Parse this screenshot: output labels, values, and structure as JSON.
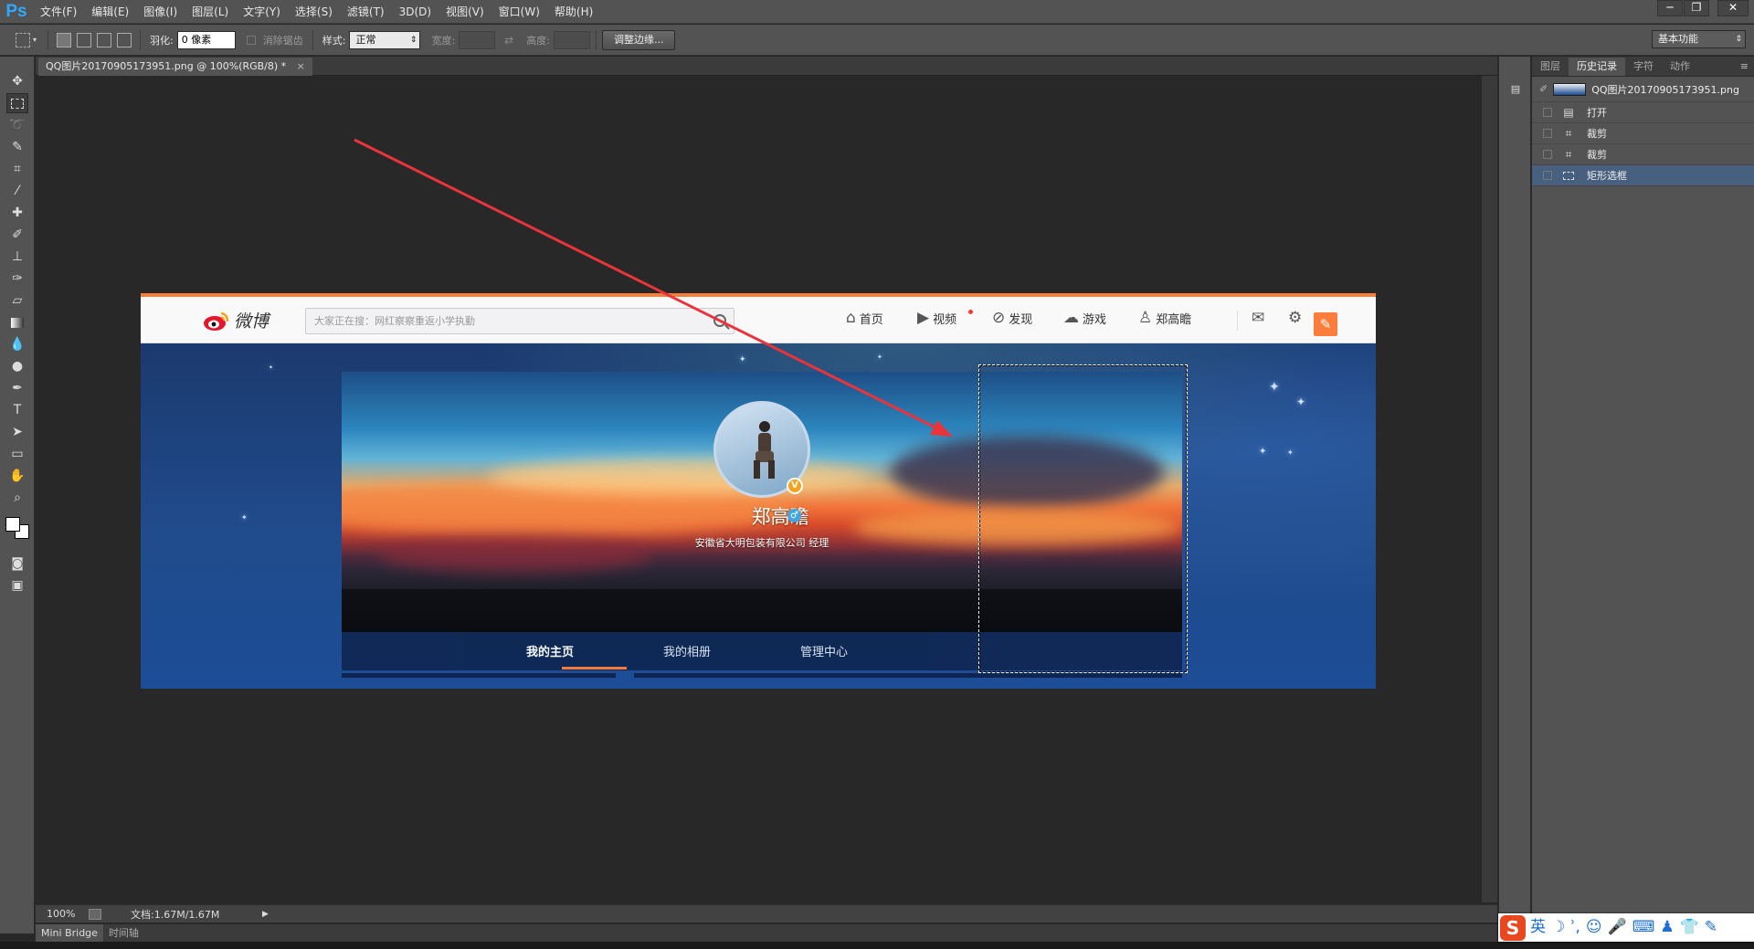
{
  "app": {
    "logo": "Ps"
  },
  "menu": [
    "文件(F)",
    "编辑(E)",
    "图像(I)",
    "图层(L)",
    "文字(Y)",
    "选择(S)",
    "滤镜(T)",
    "3D(D)",
    "视图(V)",
    "窗口(W)",
    "帮助(H)"
  ],
  "window_controls": [
    "─",
    "❐",
    "✕"
  ],
  "options": {
    "feather_label": "羽化:",
    "feather_value": "0 像素",
    "antialias_label": "消除锯齿",
    "style_label": "样式:",
    "style_value": "正常",
    "width_label": "宽度:",
    "height_label": "高度:",
    "refine_button": "调整边缘...",
    "workspace": "基本功能"
  },
  "document": {
    "tab_title": "QQ图片20170905173951.png @ 100%(RGB/8) *",
    "close": "×"
  },
  "status": {
    "zoom": "100%",
    "doc_info": "文档:1.67M/1.67M"
  },
  "bottom_tabs": [
    "Mini Bridge",
    "时间轴"
  ],
  "panel": {
    "tabs": [
      "图层",
      "历史记录",
      "字符",
      "动作"
    ],
    "active_tab": "历史记录",
    "snapshot": "QQ图片20170905173951.png",
    "history": [
      {
        "label": "打开",
        "icon": "document-icon"
      },
      {
        "label": "裁剪",
        "icon": "crop-icon"
      },
      {
        "label": "裁剪",
        "icon": "crop-icon"
      },
      {
        "label": "矩形选框",
        "icon": "marquee-icon"
      }
    ],
    "selected_history": 3
  },
  "ime": {
    "lang": "英",
    "icons": [
      "☽",
      "ʾ,",
      "☺",
      "🎤",
      "⌨",
      "♟",
      "👕",
      "✎"
    ]
  },
  "weibo": {
    "logo_text": "微博",
    "search_placeholder": "大家正在搜：网红察察重返小学执勤",
    "nav": [
      {
        "label": "首页",
        "icon": "home-icon"
      },
      {
        "label": "视频",
        "icon": "video-icon"
      },
      {
        "label": "发现",
        "icon": "compass-icon"
      },
      {
        "label": "游戏",
        "icon": "game-icon"
      },
      {
        "label": "郑高瞻",
        "icon": "user-icon"
      }
    ],
    "username": "郑高瞻",
    "bio": "安徽省大明包装有限公司 经理",
    "tabs": [
      "我的主页",
      "我的相册",
      "管理中心"
    ],
    "active_tab": "我的主页"
  },
  "colors": {
    "ps_bg": "#282828",
    "ps_panel": "#535353",
    "weibo_orange": "#fa7d3c",
    "arrow": "#e8343a",
    "history_selected": "#47607f"
  }
}
